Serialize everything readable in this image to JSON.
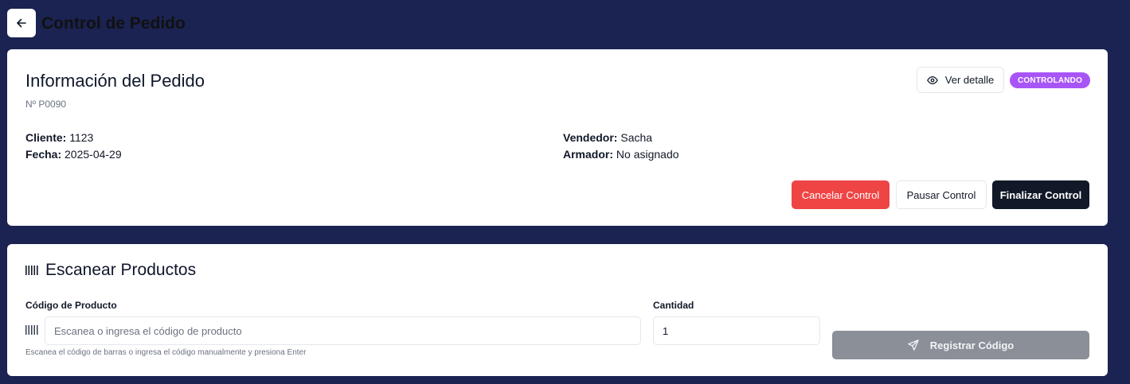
{
  "header": {
    "title": "Control de Pedido",
    "back_icon": "arrow-left-icon"
  },
  "order_info": {
    "title": "Información del Pedido",
    "number": "Nº P0090",
    "detail_button_label": "Ver detalle",
    "detail_icon": "eye-icon",
    "status_badge": "CONTROLANDO",
    "status_color": "#a855f7",
    "fields": {
      "cliente_label": "Cliente:",
      "cliente_value": "1123",
      "fecha_label": "Fecha:",
      "fecha_value": "2025-04-29",
      "vendedor_label": "Vendedor:",
      "vendedor_value": "Sacha",
      "armador_label": "Armador:",
      "armador_value": "No asignado"
    },
    "actions": {
      "cancel_label": "Cancelar Control",
      "pause_label": "Pausar Control",
      "finish_label": "Finalizar Control",
      "cancel_color": "#ef4444",
      "finish_color": "#111827"
    }
  },
  "scan": {
    "title": "Escanear Productos",
    "title_icon": "barcode-icon",
    "code_label": "Código de Producto",
    "code_placeholder": "Escanea o ingresa el código de producto",
    "code_value": "",
    "hint": "Escanea el código de barras o ingresa el código manualmente y presiona Enter",
    "quantity_label": "Cantidad",
    "quantity_value": "1",
    "register_label": "Registrar Código",
    "register_icon": "send-icon",
    "register_disabled": true
  },
  "colors": {
    "background": "#1a2352",
    "card": "#ffffff"
  }
}
